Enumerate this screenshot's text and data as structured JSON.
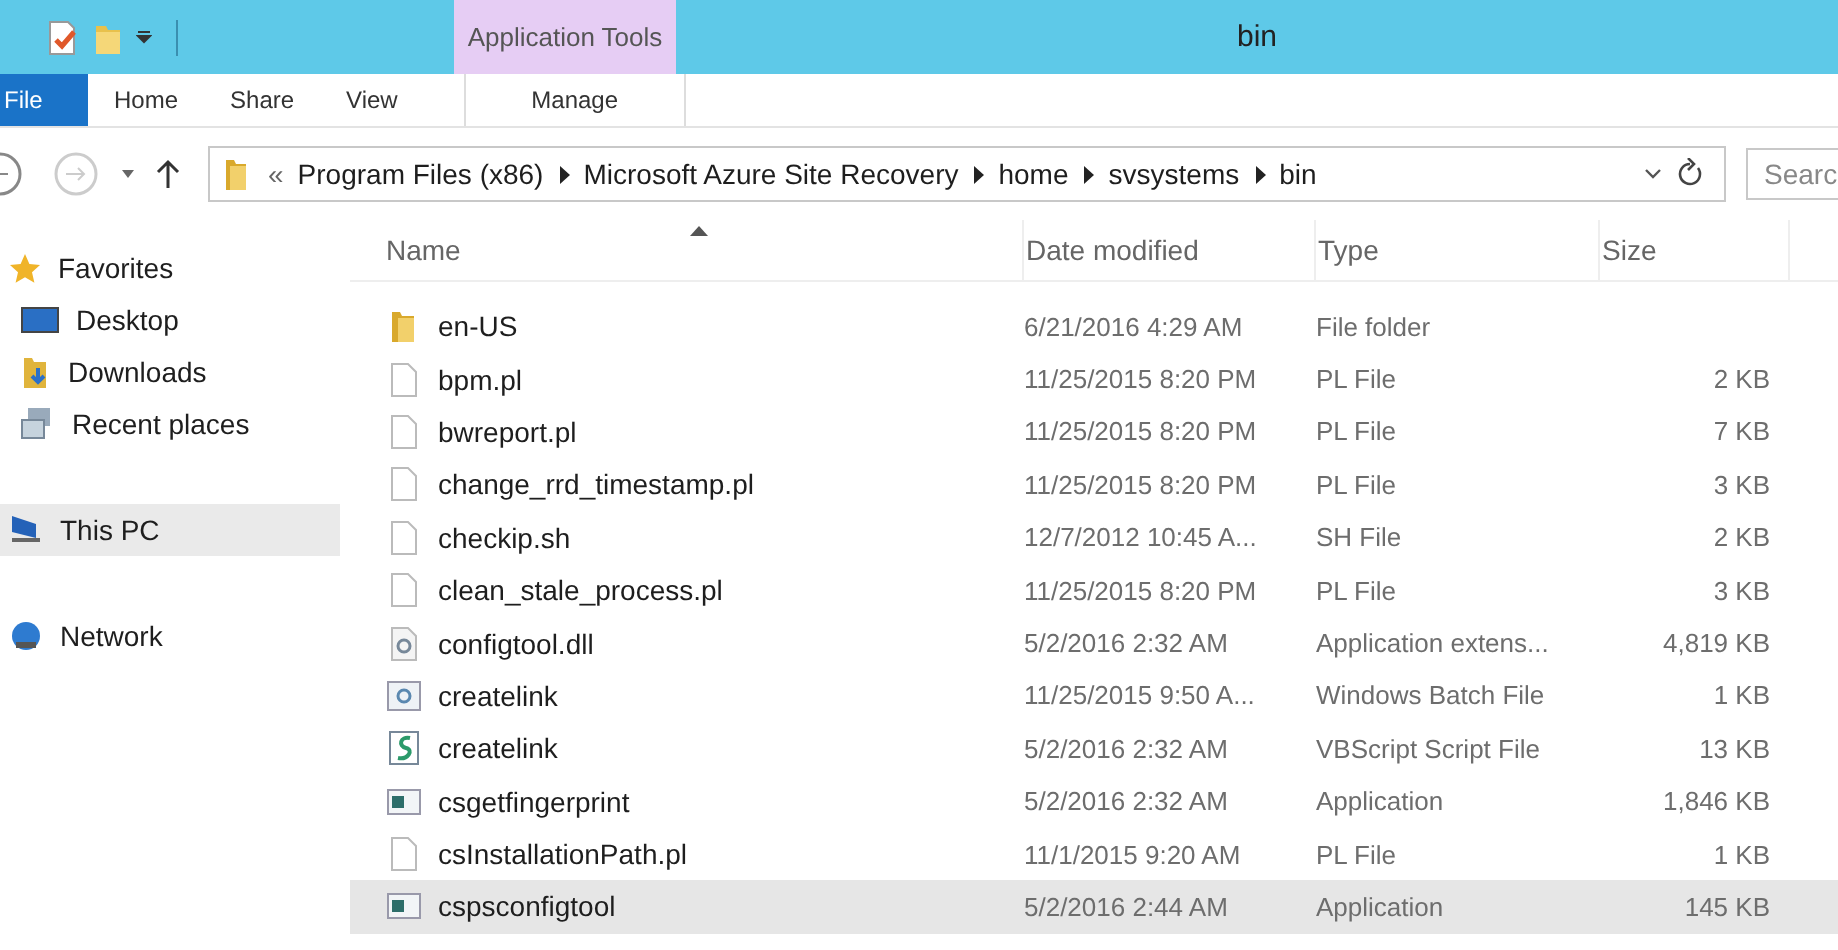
{
  "window": {
    "title": "bin",
    "context_tab": "Application Tools"
  },
  "ribbon_tabs": [
    {
      "label": "File",
      "kind": "file",
      "selected": false
    },
    {
      "label": "Home",
      "kind": "tab",
      "selected": false
    },
    {
      "label": "Share",
      "kind": "tab",
      "selected": false
    },
    {
      "label": "View",
      "kind": "tab",
      "selected": false
    },
    {
      "label": "Manage",
      "kind": "context",
      "selected": false
    }
  ],
  "address": {
    "overflow": "«",
    "segments": [
      "Program Files (x86)",
      "Microsoft Azure Site Recovery",
      "home",
      "svsystems",
      "bin"
    ]
  },
  "search": {
    "placeholder": "Searc"
  },
  "sidebar": {
    "sections": [
      {
        "items": [
          {
            "label": "Favorites",
            "kind": "star",
            "header": true,
            "selected": false
          },
          {
            "label": "Desktop",
            "kind": "desktop",
            "header": false,
            "selected": false
          },
          {
            "label": "Downloads",
            "kind": "downloads",
            "header": false,
            "selected": false
          },
          {
            "label": "Recent places",
            "kind": "recent",
            "header": false,
            "selected": false
          }
        ]
      },
      {
        "items": [
          {
            "label": "This PC",
            "kind": "pc",
            "header": true,
            "selected": true
          }
        ]
      },
      {
        "items": [
          {
            "label": "Network",
            "kind": "network",
            "header": true,
            "selected": false
          }
        ]
      }
    ]
  },
  "table": {
    "columns": [
      "Name",
      "Date modified",
      "Type",
      "Size"
    ],
    "rows": [
      {
        "name": "en-US",
        "date": "6/21/2016 4:29 AM",
        "type": "File folder",
        "size": "",
        "kind": "folder",
        "selected": false
      },
      {
        "name": "bpm.pl",
        "date": "11/25/2015 8:20 PM",
        "type": "PL File",
        "size": "2 KB",
        "kind": "file",
        "selected": false
      },
      {
        "name": "bwreport.pl",
        "date": "11/25/2015 8:20 PM",
        "type": "PL File",
        "size": "7 KB",
        "kind": "file",
        "selected": false
      },
      {
        "name": "change_rrd_timestamp.pl",
        "date": "11/25/2015 8:20 PM",
        "type": "PL File",
        "size": "3 KB",
        "kind": "file",
        "selected": false
      },
      {
        "name": "checkip.sh",
        "date": "12/7/2012 10:45 A...",
        "type": "SH File",
        "size": "2 KB",
        "kind": "file",
        "selected": false
      },
      {
        "name": "clean_stale_process.pl",
        "date": "11/25/2015 8:20 PM",
        "type": "PL File",
        "size": "3 KB",
        "kind": "file",
        "selected": false
      },
      {
        "name": "configtool.dll",
        "date": "5/2/2016 2:32 AM",
        "type": "Application extens...",
        "size": "4,819 KB",
        "kind": "dll",
        "selected": false
      },
      {
        "name": "createlink",
        "date": "11/25/2015 9:50 A...",
        "type": "Windows Batch File",
        "size": "1 KB",
        "kind": "batch",
        "selected": false
      },
      {
        "name": "createlink",
        "date": "5/2/2016 2:32 AM",
        "type": "VBScript Script File",
        "size": "13 KB",
        "kind": "script",
        "selected": false
      },
      {
        "name": "csgetfingerprint",
        "date": "5/2/2016 2:32 AM",
        "type": "Application",
        "size": "1,846 KB",
        "kind": "app",
        "selected": false
      },
      {
        "name": "csInstallationPath.pl",
        "date": "11/1/2015 9:20 AM",
        "type": "PL File",
        "size": "1 KB",
        "kind": "file",
        "selected": false
      },
      {
        "name": "cspsconfigtool",
        "date": "5/2/2016 2:44 AM",
        "type": "Application",
        "size": "145 KB",
        "kind": "app",
        "selected": true
      }
    ]
  }
}
